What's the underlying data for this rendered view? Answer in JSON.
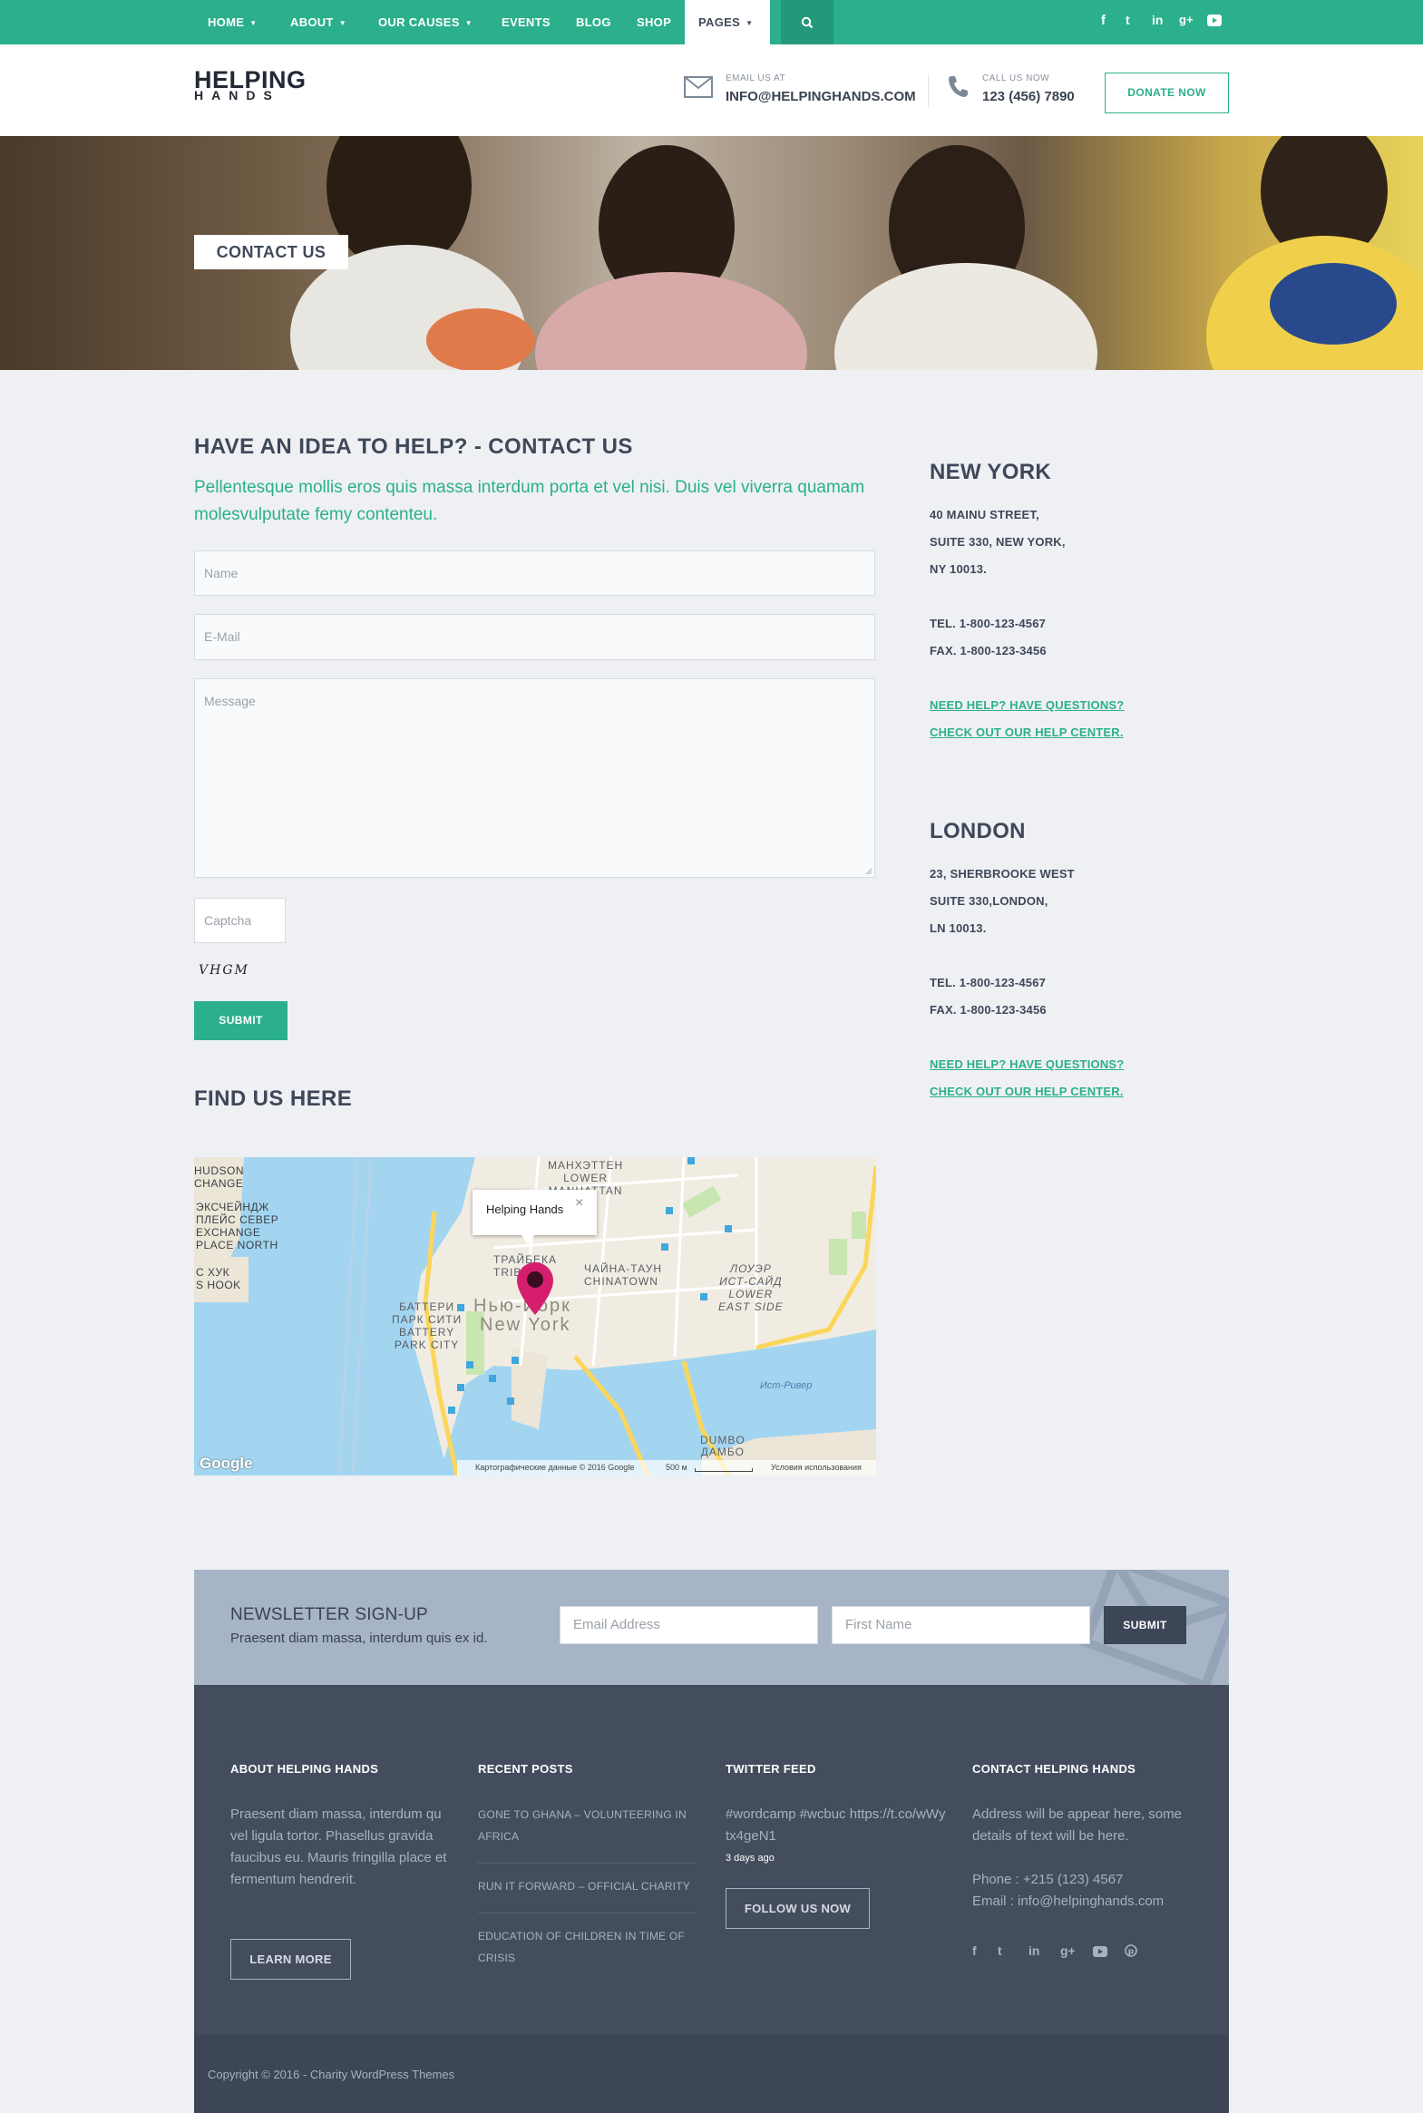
{
  "nav": {
    "items": [
      {
        "label": "HOME",
        "has_caret": true
      },
      {
        "label": "ABOUT",
        "has_caret": true
      },
      {
        "label": "OUR CAUSES",
        "has_caret": true
      },
      {
        "label": "EVENTS",
        "has_caret": false
      },
      {
        "label": "BLOG",
        "has_caret": false
      },
      {
        "label": "SHOP",
        "has_caret": false
      },
      {
        "label": "PAGES",
        "has_caret": true,
        "active": true
      }
    ],
    "search_icon": "search-icon",
    "social_icons": [
      "facebook-icon",
      "twitter-icon",
      "linkedin-icon",
      "google-plus-icon",
      "youtube-icon"
    ]
  },
  "header": {
    "logo_line1": "HELPING",
    "logo_line2": "HANDS",
    "email_label": "EMAIL US AT",
    "email_value": "INFO@HELPINGHANDS.COM",
    "phone_label": "CALL US NOW",
    "phone_value": "123 (456) 7890",
    "donate_label": "DONATE NOW"
  },
  "hero": {
    "badge": "CONTACT US"
  },
  "contact": {
    "title": "HAVE AN IDEA TO HELP? - CONTACT US",
    "lead": "Pellentesque mollis eros quis massa interdum porta et vel nisi. Duis vel viverra quamam molesvulputate femy contenteu.",
    "name_placeholder": "Name",
    "email_placeholder": "E-Mail",
    "message_placeholder": "Message",
    "captcha_placeholder": "Captcha",
    "captcha_code": "VHGM",
    "submit_label": "SUBMIT"
  },
  "map": {
    "title": "FIND US HERE",
    "popup_label": "Helping Hands",
    "labels": {
      "lower_manhattan": "МАНХЭТТЕН\nLOWER\nMANHATTAN",
      "chinatown": "ЧАЙНА-ТАУН\nCHINATOWN",
      "les": "ЛОУЭР\nИСТ-САЙД\nLOWER\nEAST SIDE",
      "tribeca": "ТРАЙБЕКА\nTRIBECA",
      "battery": "БАТТЕРИ\nПАРК СИТИ\nBATTERY\nPARK CITY",
      "exchange": "ЭКСЧЕЙНДЖ\nПЛЕЙС СЕВЕР\nEXCHANGE\nPLACE NORTH",
      "hudson": "HUDSON\nCHANGE",
      "hook": "С ХУК\nS HOOK",
      "ny_ru": "Нью-Йорк",
      "ny_en": "New York",
      "east_river": "Ист-Ривер",
      "dumbo": "DUMBO\nДАМБО"
    },
    "google": "Google",
    "attribution": "Картографические данные © 2016 Google",
    "scale": "500 м",
    "terms": "Условия использования",
    "colors": {
      "water": "#a3d5f0",
      "land": "#f1ece2",
      "park": "#c8e6b0",
      "road": "#fbd65a",
      "pin": "#d51f6e"
    }
  },
  "offices": [
    {
      "city": "NEW YORK",
      "address": [
        "40 MAINU STREET,",
        "SUITE 330, NEW YORK,",
        "NY 10013."
      ],
      "tel": "TEL. 1-800-123-4567",
      "fax": "FAX. 1-800-123-3456",
      "link1": "NEED HELP? HAVE QUESTIONS?",
      "link2": "CHECK OUT OUR HELP CENTER."
    },
    {
      "city": "LONDON",
      "address": [
        "23, SHERBROOKE WEST",
        "SUITE 330,LONDON,",
        "LN 10013."
      ],
      "tel": "TEL. 1-800-123-4567",
      "fax": "FAX. 1-800-123-3456",
      "link1": "NEED HELP? HAVE QUESTIONS?",
      "link2": "CHECK OUT OUR HELP CENTER."
    }
  ],
  "newsletter": {
    "title": "NEWSLETTER SIGN-UP",
    "subtitle": "Praesent diam massa, interdum quis ex id.",
    "email_placeholder": "Email Address",
    "name_placeholder": "First Name",
    "submit_label": "SUBMIT"
  },
  "footer": {
    "about": {
      "heading": "ABOUT HELPING HANDS",
      "text": "Praesent diam massa, interdum qu vel ligula tortor. Phasellus gravida faucibus eu. Mauris fringilla place et fermentum hendrerit.",
      "button": "LEARN MORE"
    },
    "recent": {
      "heading": "RECENT POSTS",
      "posts": [
        "GONE TO GHANA – VOLUNTEERING IN AFRICA",
        "RUN IT FORWARD – OFFICIAL CHARITY",
        "EDUCATION OF CHILDREN IN TIME OF CRISIS"
      ]
    },
    "twitter": {
      "heading": "TWITTER FEED",
      "tweet": "#wordcamp #wcbuc https://t.co/wWytx4geN1",
      "time": "3 days ago",
      "button": "FOLLOW US NOW"
    },
    "contact": {
      "heading": "CONTACT HELPING HANDS",
      "address": "Address will be appear here, some details of text will be here.",
      "phone": "Phone : +215 (123) 4567",
      "email": "Email : info@helpinghands.com",
      "social_icons": [
        "facebook-icon",
        "twitter-icon",
        "linkedin-icon",
        "google-plus-icon",
        "youtube-icon",
        "pinterest-icon"
      ]
    },
    "copyright": "Copyright © 2016 - Charity WordPress Themes"
  },
  "colors": {
    "accent": "#2bb08b",
    "dark": "#3e4858",
    "footer": "#434d5e",
    "newsletter": "#a6b4c6"
  }
}
